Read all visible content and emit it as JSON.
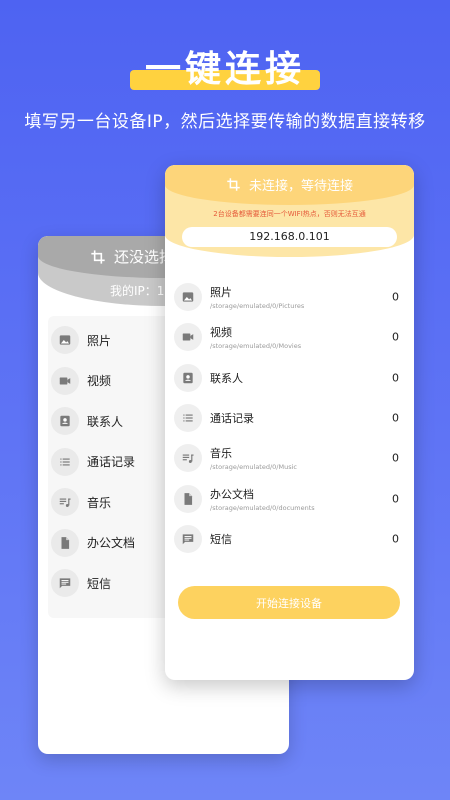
{
  "hero": {
    "title": "一键连接",
    "subtitle": "填写另一台设备IP，然后选择要传输的数据直接转移",
    "accent": "#ffd23f"
  },
  "back_card": {
    "title": "还没选择",
    "ip_label": "我的IP：192",
    "items": [
      {
        "label": "照片",
        "icon": "photo-icon"
      },
      {
        "label": "视频",
        "icon": "video-icon"
      },
      {
        "label": "联系人",
        "icon": "contact-icon"
      },
      {
        "label": "通话记录",
        "icon": "call-log-icon"
      },
      {
        "label": "音乐",
        "icon": "music-icon"
      },
      {
        "label": "办公文档",
        "icon": "document-icon"
      },
      {
        "label": "短信",
        "icon": "message-icon"
      }
    ]
  },
  "front_card": {
    "status": "未连接，等待连接",
    "warning": "2台设备都需要连同一个WIFI热点，否则无法互通",
    "ip_value": "192.168.0.101",
    "items": [
      {
        "label": "照片",
        "path": "/storage/emulated/0/Pictures",
        "count": "0",
        "icon": "photo-icon"
      },
      {
        "label": "视频",
        "path": "/storage/emulated/0/Movies",
        "count": "0",
        "icon": "video-icon"
      },
      {
        "label": "联系人",
        "path": "",
        "count": "0",
        "icon": "contact-icon"
      },
      {
        "label": "通话记录",
        "path": "",
        "count": "0",
        "icon": "call-log-icon"
      },
      {
        "label": "音乐",
        "path": "/storage/emulated/0/Music",
        "count": "0",
        "icon": "music-icon"
      },
      {
        "label": "办公文档",
        "path": "/storage/emulated/0/documents",
        "count": "0",
        "icon": "document-icon"
      },
      {
        "label": "短信",
        "path": "",
        "count": "0",
        "icon": "message-icon"
      }
    ],
    "start_button": "开始连接设备",
    "accent": "#fdd25f"
  }
}
